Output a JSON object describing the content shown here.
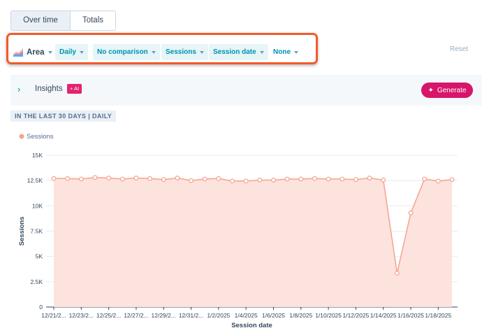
{
  "tabs": {
    "over_time": "Over time",
    "totals": "Totals"
  },
  "filters": {
    "chart_type": "Area",
    "frequency": "Daily",
    "comparison": "No comparison",
    "measure": "Sessions",
    "dimension": "Session date",
    "breakdown": "None"
  },
  "reset_label": "Reset",
  "insights": {
    "label": "Insights",
    "ai_badge": "+ AI",
    "generate_label": "Generate"
  },
  "range_tag": "IN THE LAST 30 DAYS | DAILY",
  "colors": {
    "accent": "#0091ae",
    "highlight": "#f25a2a",
    "series_line": "#f5a28f",
    "series_fill": "#fde3dd",
    "generate": "#d7156a"
  },
  "chart_data": {
    "type": "area",
    "title": "",
    "xlabel": "Session date",
    "ylabel": "Sessions",
    "ylim": [
      0,
      15000
    ],
    "yticks": [
      0,
      2500,
      5000,
      7500,
      10000,
      12500,
      15000
    ],
    "ytick_labels": [
      "0",
      "2.5K",
      "5K",
      "7.5K",
      "10K",
      "12.5K",
      "15K"
    ],
    "grid": true,
    "legend": "top-left",
    "x": [
      "12/21/2024",
      "12/22/2024",
      "12/23/2024",
      "12/24/2024",
      "12/25/2024",
      "12/26/2024",
      "12/27/2024",
      "12/28/2024",
      "12/29/2024",
      "12/30/2024",
      "12/31/2024",
      "1/1/2025",
      "1/2/2025",
      "1/3/2025",
      "1/4/2025",
      "1/5/2025",
      "1/6/2025",
      "1/7/2025",
      "1/8/2025",
      "1/9/2025",
      "1/10/2025",
      "1/11/2025",
      "1/12/2025",
      "1/13/2025",
      "1/14/2025",
      "1/15/2025",
      "1/16/2025",
      "1/17/2025",
      "1/18/2025",
      "1/19/2025"
    ],
    "xtick_labels": [
      "12/21/2...",
      "12/23/2...",
      "12/25/2...",
      "12/27/2...",
      "12/29/2...",
      "12/31/2...",
      "1/2/2025",
      "1/4/2025",
      "1/6/2025",
      "1/8/2025",
      "1/10/2025",
      "1/12/2025",
      "1/14/2025",
      "1/16/2025",
      "1/18/2025"
    ],
    "series": [
      {
        "name": "Sessions",
        "values": [
          12700,
          12700,
          12650,
          12800,
          12750,
          12650,
          12750,
          12700,
          12600,
          12750,
          12500,
          12650,
          12700,
          12450,
          12450,
          12550,
          12550,
          12650,
          12650,
          12700,
          12650,
          12650,
          12600,
          12750,
          12550,
          3350,
          9300,
          12650,
          12450,
          12600
        ]
      }
    ]
  }
}
